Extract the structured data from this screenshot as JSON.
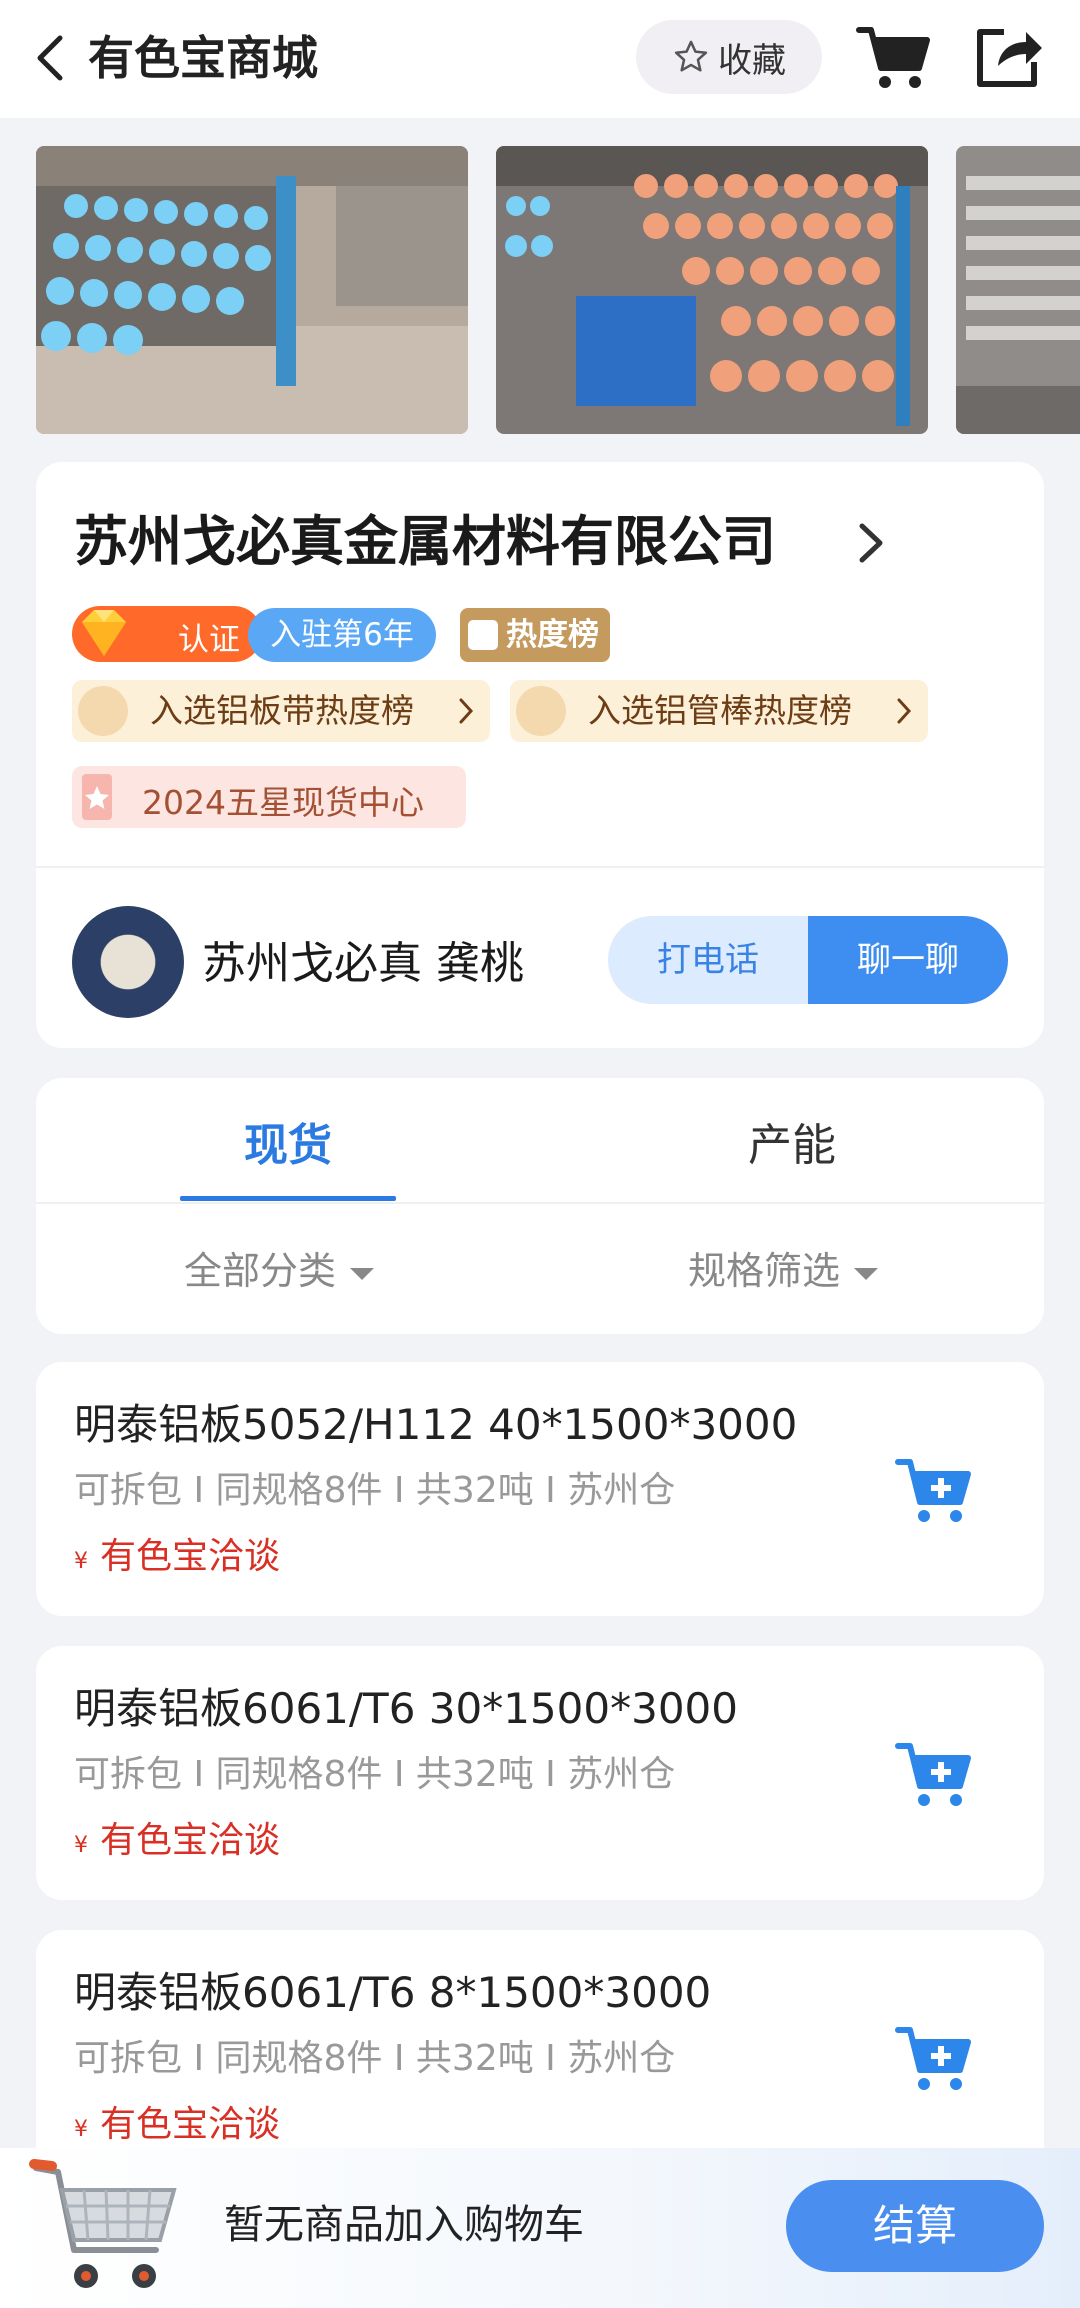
{
  "header": {
    "title": "有色宝商城",
    "favorite_label": "收藏"
  },
  "company": {
    "name": "苏州戈必真金属材料有限公司",
    "cert_label": "认证",
    "years_label": "入驻第6年",
    "hot_label": "热度榜",
    "ranks": [
      "入选铝板带热度榜",
      "入选铝管棒热度榜"
    ],
    "award": "2024五星现货中心",
    "contact_name": "苏州戈必真 龚桃",
    "call_label": "打电话",
    "chat_label": "聊一聊"
  },
  "tabs": {
    "active": "现货",
    "other": "产能",
    "filters": [
      "全部分类",
      "规格筛选"
    ]
  },
  "products": [
    {
      "title": "明泰铝板5052/H112 40*1500*3000",
      "meta": "可拆包 I 同规格8件 I 共32吨 I 苏州仓",
      "currency": "¥",
      "price": "有色宝洽谈"
    },
    {
      "title": "明泰铝板6061/T6 30*1500*3000",
      "meta": "可拆包 I 同规格8件 I 共32吨 I 苏州仓",
      "currency": "¥",
      "price": "有色宝洽谈"
    },
    {
      "title": "明泰铝板6061/T6 8*1500*3000",
      "meta": "可拆包 I 同规格8件 I 共32吨 I 苏州仓",
      "currency": "¥",
      "price": "有色宝洽谈"
    }
  ],
  "bottom": {
    "message": "暂无商品加入购物车",
    "checkout_label": "结算"
  },
  "colors": {
    "accent": "#2a7ae2",
    "price": "#d93025",
    "cert": "#ff6a2b",
    "year_badge": "#5aa8f5",
    "hot_badge": "#c49a5e"
  },
  "icons": [
    "back-icon",
    "star-icon",
    "cart-icon",
    "share-icon",
    "chevron-right-icon",
    "diamond-icon",
    "add-to-cart-icon",
    "trolley-icon"
  ]
}
